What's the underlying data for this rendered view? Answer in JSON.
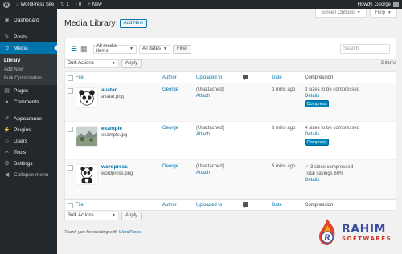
{
  "adminbar": {
    "logo": "W",
    "site_name": "WordPress Site",
    "updates_count": "1",
    "comments_count": "0",
    "new_label": "New",
    "greeting": "Howdy, George"
  },
  "sidebar": {
    "items": [
      {
        "label": "Dashboard",
        "icon": "dashboard-icon",
        "glyph": "◉"
      },
      {
        "label": "Posts",
        "icon": "pin-icon",
        "glyph": "✎"
      },
      {
        "label": "Media",
        "icon": "media-icon",
        "glyph": "♫"
      },
      {
        "label": "Pages",
        "icon": "page-icon",
        "glyph": "▤"
      },
      {
        "label": "Comments",
        "icon": "comment-icon",
        "glyph": "●"
      },
      {
        "label": "Appearance",
        "icon": "brush-icon",
        "glyph": "✐"
      },
      {
        "label": "Plugins",
        "icon": "plugin-icon",
        "glyph": "⚡"
      },
      {
        "label": "Users",
        "icon": "users-icon",
        "glyph": "☺"
      },
      {
        "label": "Tools",
        "icon": "tools-icon",
        "glyph": "✂"
      },
      {
        "label": "Settings",
        "icon": "settings-icon",
        "glyph": "⚙"
      },
      {
        "label": "Collapse menu",
        "icon": "collapse-icon",
        "glyph": "◀"
      }
    ],
    "submenu": [
      "Library",
      "Add New",
      "Bulk Optimization"
    ]
  },
  "screen_meta": {
    "screen_options": "Screen Options",
    "help": "Help"
  },
  "page": {
    "title": "Media Library",
    "add_new": "Add New"
  },
  "filters": {
    "media_type": "All media items",
    "dates": "All dates",
    "filter_button": "Filter",
    "search_placeholder": "Search"
  },
  "tablenav": {
    "bulk_actions": "Bulk Actions",
    "apply": "Apply",
    "count": "3 items"
  },
  "columns": {
    "file": "File",
    "author": "Author",
    "uploaded_to": "Uploaded to",
    "date": "Date",
    "compression": "Compression"
  },
  "rows": [
    {
      "title": "avatar",
      "filename": "avatar.png",
      "author": "George",
      "uploaded": "(Unattached)",
      "attach": "Attach",
      "date": "3 mins ago",
      "status": "3 sizes to be compressed",
      "details": "Details",
      "button": "Compress"
    },
    {
      "title": "example",
      "filename": "example.jpg",
      "author": "George",
      "uploaded": "(Unattached)",
      "attach": "Attach",
      "date": "3 mins ago",
      "status": "4 sizes to be compressed",
      "details": "Details",
      "button": "Compress"
    },
    {
      "title": "wordpress",
      "filename": "wordpress.png",
      "author": "George",
      "uploaded": "(Unattached)",
      "attach": "Attach",
      "date": "5 mins ago",
      "status": "3 sizes compressed",
      "savings": "Total savings 60%",
      "details": "Details"
    }
  ],
  "footer": {
    "text_prefix": "Thank you for creating with ",
    "link": "WordPress",
    "text_suffix": "."
  },
  "watermark": {
    "big": "RAHIM",
    "small": "SOFTWARES",
    "letter": "R"
  }
}
